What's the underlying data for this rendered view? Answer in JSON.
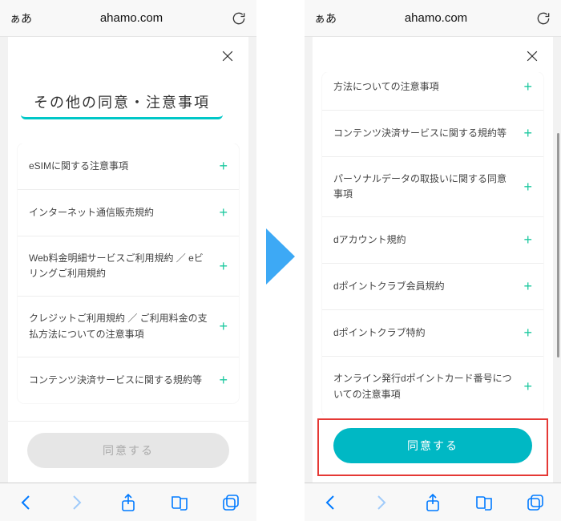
{
  "browser": {
    "aa": "ぁあ",
    "url": "ahamo.com"
  },
  "left": {
    "title": "その他の同意・注意事項",
    "rows": [
      "eSIMに関する注意事項",
      "インターネット通信販売規約",
      "Web料金明細サービスご利用規約 ／ eビリングご利用規約",
      "クレジットご利用規約 ／ ご利用料金の支払方法についての注意事項",
      "コンテンツ決済サービスに関する規約等"
    ],
    "agree": "同意する"
  },
  "right": {
    "rows": [
      "方法についての注意事項",
      "コンテンツ決済サービスに関する規約等",
      "パーソナルデータの取扱いに関する同意事項",
      "dアカウント規約",
      "dポイントクラブ会員規約",
      "dポイントクラブ特約",
      "オンライン発行dポイントカード番号についての注意事項"
    ],
    "agree": "同意する"
  }
}
